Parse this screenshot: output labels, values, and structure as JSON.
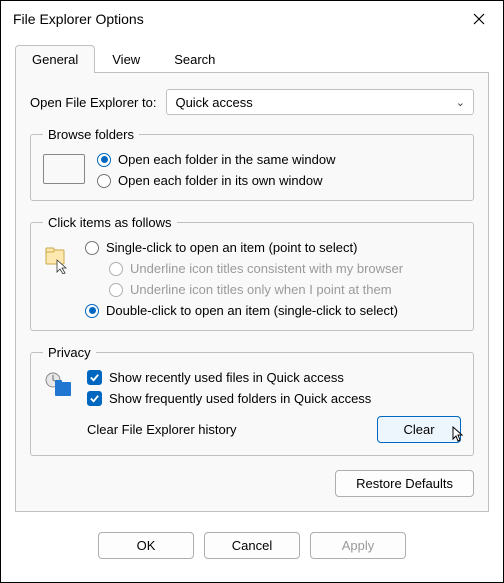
{
  "title": "File Explorer Options",
  "tabs": [
    "General",
    "View",
    "Search"
  ],
  "open": {
    "label": "Open File Explorer to:",
    "value": "Quick access"
  },
  "browse": {
    "legend": "Browse folders",
    "opt_same": "Open each folder in the same window",
    "opt_own": "Open each folder in its own window"
  },
  "click": {
    "legend": "Click items as follows",
    "opt_single": "Single-click to open an item (point to select)",
    "opt_ul_browser": "Underline icon titles consistent with my browser",
    "opt_ul_point": "Underline icon titles only when I point at them",
    "opt_double": "Double-click to open an item (single-click to select)"
  },
  "privacy": {
    "legend": "Privacy",
    "opt_recent": "Show recently used files in Quick access",
    "opt_frequent": "Show frequently used folders in Quick access",
    "clear_label": "Clear File Explorer history",
    "clear_btn": "Clear"
  },
  "restore": "Restore Defaults",
  "footer": {
    "ok": "OK",
    "cancel": "Cancel",
    "apply": "Apply"
  }
}
